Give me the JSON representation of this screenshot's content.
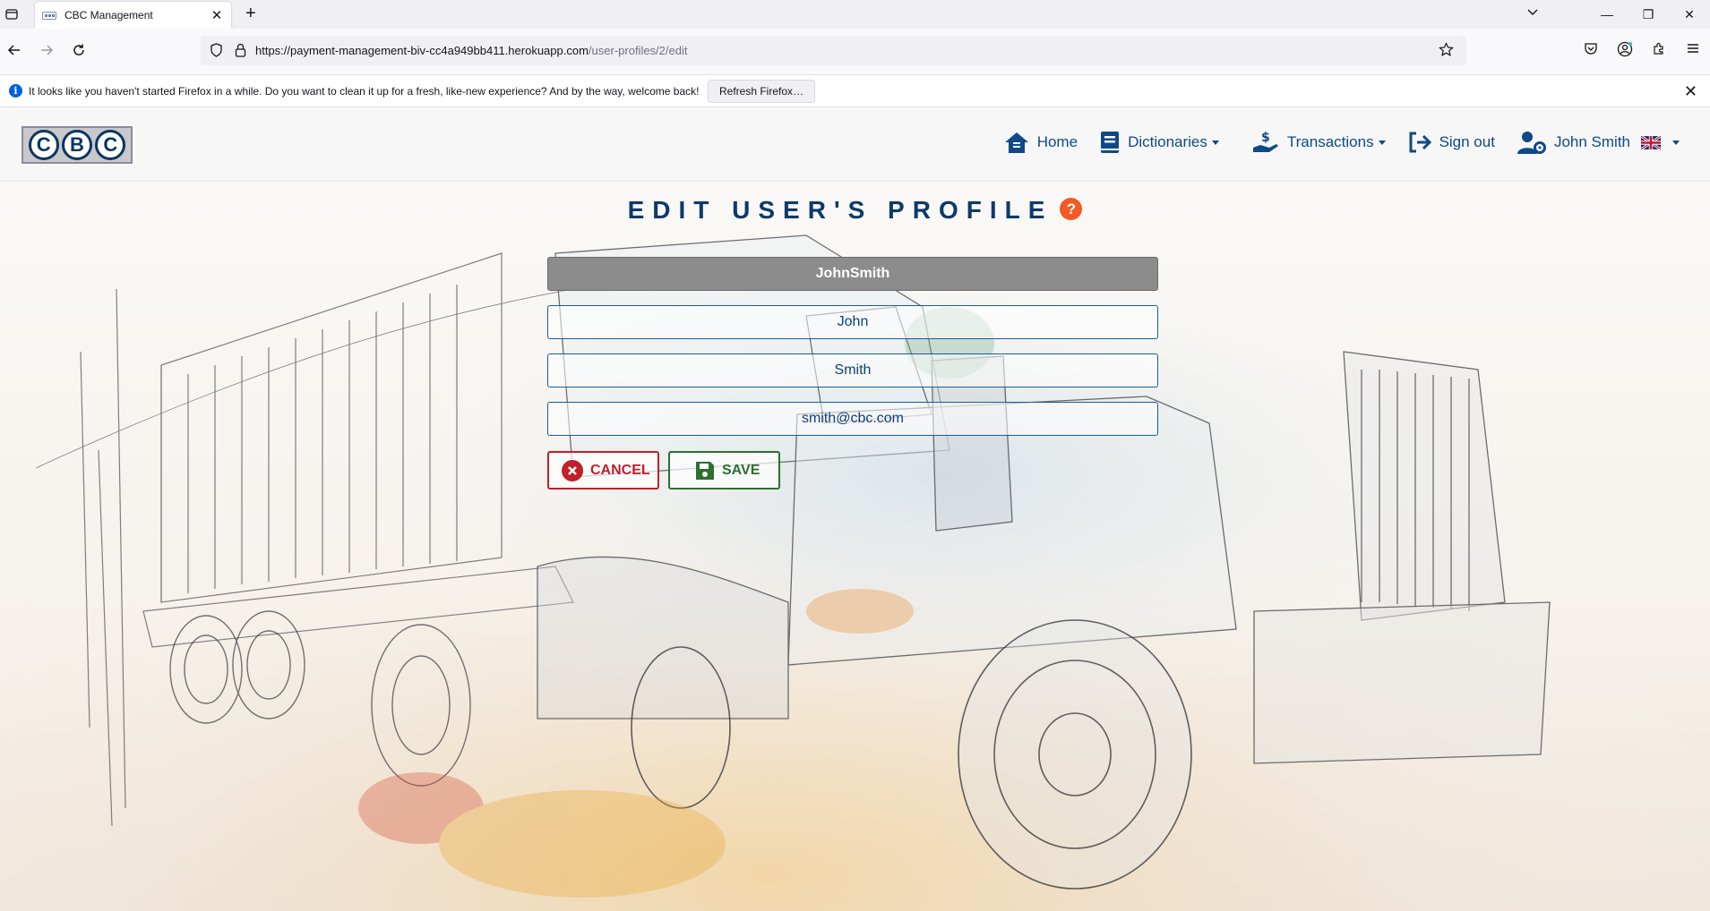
{
  "browser": {
    "tab_title": "CBC Management",
    "url_main": "https://payment-management-biv-cc4a949bb411.herokuapp.com",
    "url_path": "/user-profiles/2/edit",
    "notice_text": "It looks like you haven't started Firefox in a while. Do you want to clean it up for a fresh, like-new experience? And by the way, welcome back!",
    "notice_button": "Refresh Firefox…"
  },
  "app": {
    "logo_letters": [
      "C",
      "B",
      "C"
    ],
    "menu": {
      "home": "Home",
      "dictionaries": "Dictionaries",
      "transactions": "Transactions",
      "signout": "Sign out",
      "user": "John Smith"
    }
  },
  "form": {
    "title": "EDIT USER'S PROFILE",
    "help_label": "?",
    "username": "JohnSmith",
    "first_name": "John",
    "last_name": "Smith",
    "email": "smith@cbc.com",
    "cancel_label": "CANCEL",
    "save_label": "SAVE"
  },
  "colors": {
    "brand": "#0d4a86",
    "help": "#f15a24",
    "cancel": "#c0202a",
    "save": "#2e6e2e"
  }
}
